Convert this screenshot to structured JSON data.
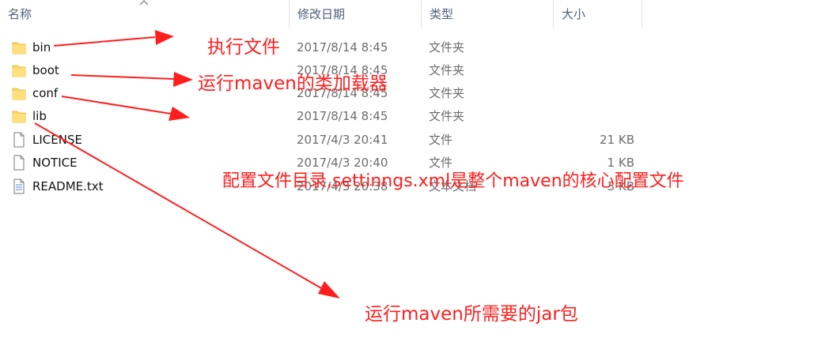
{
  "columns": {
    "name": "名称",
    "modified": "修改日期",
    "type": "类型",
    "size": "大小"
  },
  "files": [
    {
      "name": "bin",
      "icon": "folder-icon",
      "date": "2017/8/14 8:45",
      "type": "文件夹",
      "size": ""
    },
    {
      "name": "boot",
      "icon": "folder-icon",
      "date": "2017/8/14 8:45",
      "type": "文件夹",
      "size": ""
    },
    {
      "name": "conf",
      "icon": "folder-icon",
      "date": "2017/8/14 8:45",
      "type": "文件夹",
      "size": ""
    },
    {
      "name": "lib",
      "icon": "folder-icon",
      "date": "2017/8/14 8:45",
      "type": "文件夹",
      "size": ""
    },
    {
      "name": "LICENSE",
      "icon": "file-icon",
      "date": "2017/4/3 20:41",
      "type": "文件",
      "size": "21 KB"
    },
    {
      "name": "NOTICE",
      "icon": "file-icon",
      "date": "2017/4/3 20:40",
      "type": "文件",
      "size": "1 KB"
    },
    {
      "name": "README.txt",
      "icon": "text-file-icon",
      "date": "2017/4/3 20:38",
      "type": "文本文档",
      "size": "3 KB"
    }
  ],
  "annotations": {
    "bin": "执行文件",
    "boot": "运行maven的类加载器",
    "conf": "配置文件目录,settinngs.xml是整个maven的核心配置文件",
    "lib": "运行maven所需要的jar包"
  },
  "colors": {
    "annotation": "#ff1e1e",
    "folder": "#ffd560",
    "header_text": "#4c607a"
  }
}
